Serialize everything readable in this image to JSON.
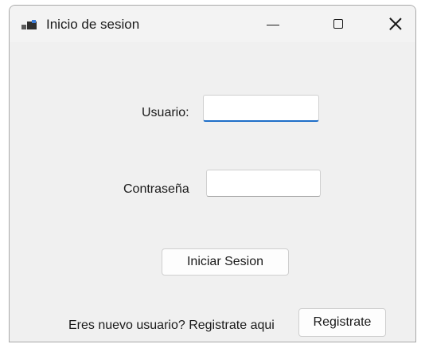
{
  "window": {
    "title": "Inicio de sesion"
  },
  "form": {
    "username_label": "Usuario:",
    "username_value": "",
    "password_label": "Contraseña",
    "password_value": "",
    "login_button": "Iniciar Sesion",
    "register_prompt": "Eres nuevo usuario? Registrate aqui",
    "register_button": "Registrate"
  },
  "icons": {
    "app": "app-window-icon",
    "minimize": "minimize-icon",
    "maximize": "maximize-icon",
    "close": "close-icon"
  },
  "colors": {
    "focus_accent": "#1f6fc8",
    "window_bg": "#f0f0f0"
  }
}
